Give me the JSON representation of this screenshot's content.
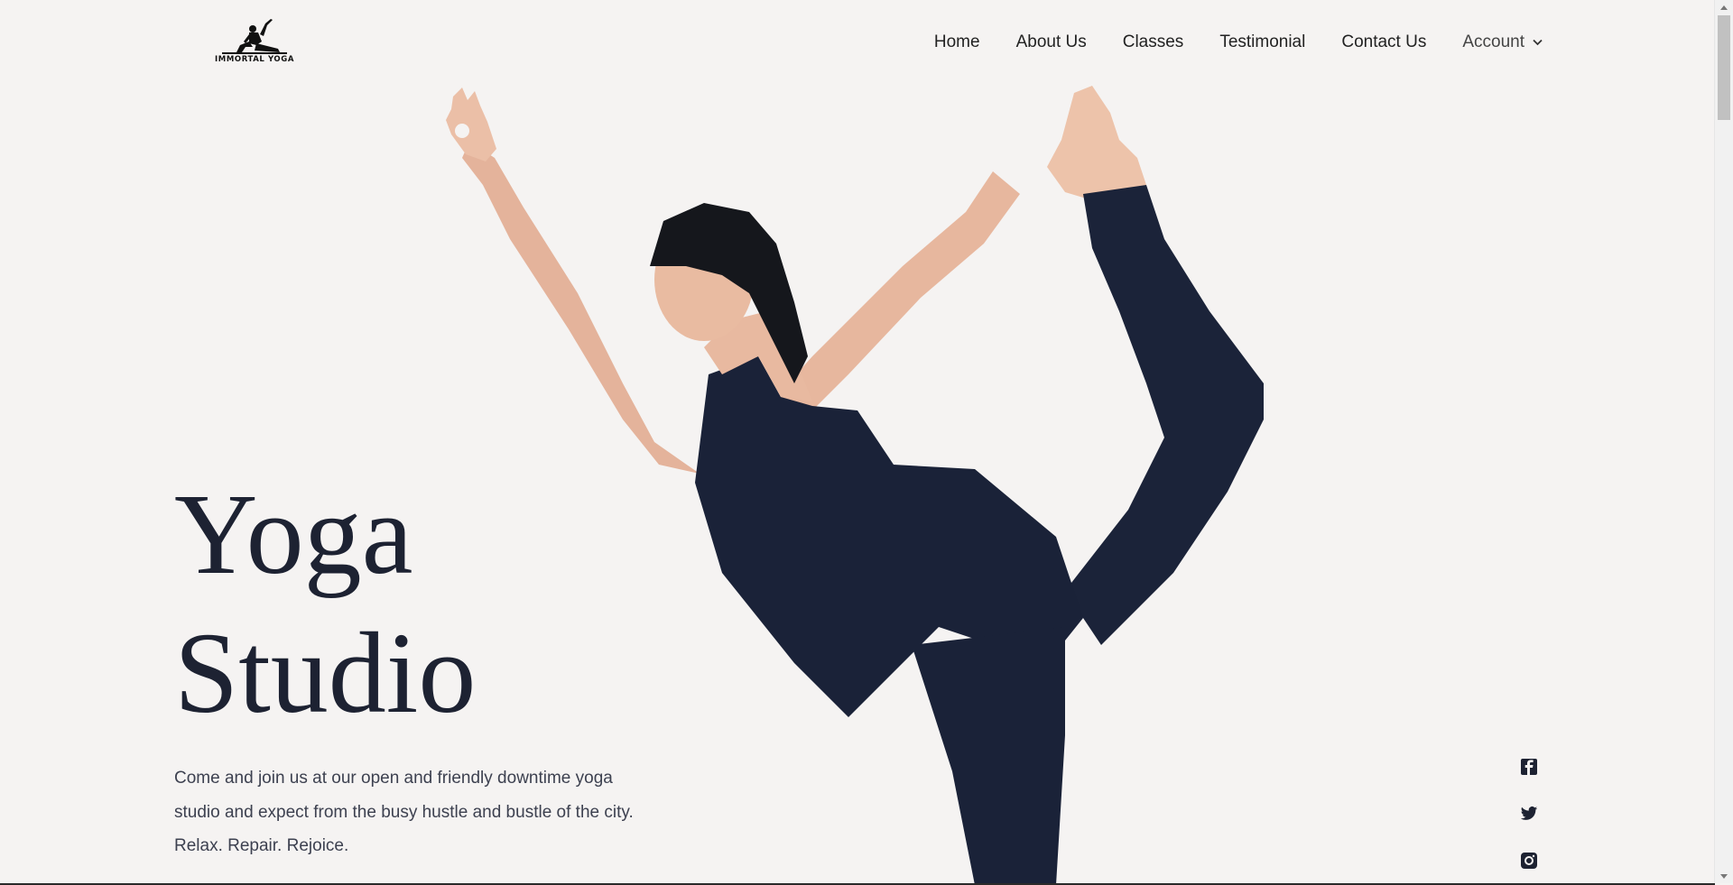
{
  "header": {
    "logo_text": "IMMORTAL YOGA",
    "logo_icon": "yoga-pose-silhouette",
    "nav": {
      "home": "Home",
      "about": "About Us",
      "classes": "Classes",
      "testimonial": "Testimonial",
      "contact": "Contact Us",
      "account": "Account"
    }
  },
  "hero": {
    "title_line1": "Yoga",
    "title_line2": "Studio",
    "description": "Come and join us at our open and friendly downtime yoga studio and expect from the busy hustle and bustle of the city. Relax. Repair. Rejoice.",
    "image": "woman-in-dancer-yoga-pose"
  },
  "social": {
    "icons": [
      "facebook-icon",
      "twitter-icon",
      "instagram-icon"
    ]
  },
  "colors": {
    "background": "#f5f3f2",
    "text_dark": "#1d2232",
    "outfit": "#1a2238",
    "skin": "#e8b9a0"
  }
}
